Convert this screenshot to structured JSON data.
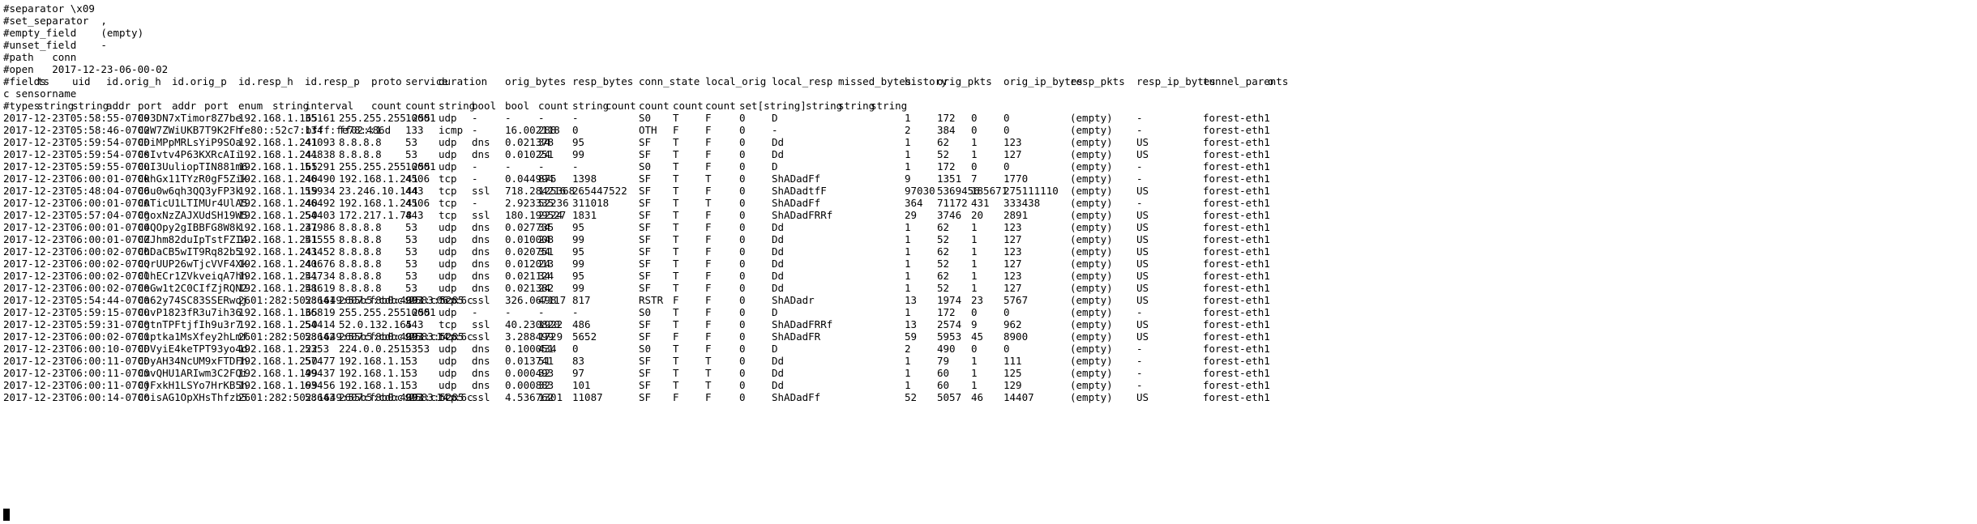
{
  "header": [
    "#separator \\x09",
    "#set_separator  ,",
    "#empty_field    (empty)",
    "#unset_field    -",
    "#path   conn",
    "#open   2017-12-23-06-00-02"
  ],
  "fields_line": [
    "#fields",
    "ts",
    "uid",
    "id.orig_h",
    "id.orig_p",
    "id.resp_h",
    "id.resp_p",
    "proto",
    "service",
    "duration",
    "orig_bytes",
    "resp_bytes",
    "conn_state",
    "local_orig",
    "local_resp",
    "missed_bytes",
    "history",
    "orig_pkts",
    "orig_ip_bytes",
    "resp_pkts",
    "resp_ip_bytes",
    "tunnel_parents",
    "o"
  ],
  "fields_wrap": "c sensorname",
  "types_line": [
    "#types",
    "string",
    "string",
    "addr",
    "port",
    "addr",
    "port",
    "enum",
    "string",
    "interval",
    "count",
    "count",
    "string",
    "bool",
    "bool",
    "count",
    "string",
    "count",
    "count",
    "count",
    "count",
    "set[string]",
    "string",
    "string",
    "string"
  ],
  "rows": [
    [
      "2017-12-23T05:58:55-0700",
      "C93DN7xTimor8Z7be",
      "192.168.1.165",
      "35161",
      "255.255.255.255",
      "10001",
      "udp",
      "-",
      "-",
      "-",
      "-",
      "S0",
      "T",
      "F",
      "0",
      "D",
      "1",
      "172",
      "0",
      "0",
      "(empty)",
      "-",
      "forest-eth1"
    ],
    [
      "2017-12-23T05:58:46-0700",
      "C2W7ZWiUKB7T9K2Fh",
      "fe80::52c7:bfff:fe78:486d",
      "134",
      "ff02::1",
      "133",
      "icmp",
      "-",
      "16.002118",
      "288",
      "0",
      "OTH",
      "F",
      "F",
      "0",
      "-",
      "2",
      "384",
      "0",
      "0",
      "(empty)",
      "-",
      "forest-eth1"
    ],
    [
      "2017-12-23T05:59:54-0700",
      "CDiMPpMRLsYiP9SOa",
      "192.168.1.241",
      "41093",
      "8.8.8.8",
      "53",
      "udp",
      "dns",
      "0.021378",
      "34",
      "95",
      "SF",
      "T",
      "F",
      "0",
      "Dd",
      "1",
      "62",
      "1",
      "123",
      "(empty)",
      "US",
      "forest-eth1"
    ],
    [
      "2017-12-23T05:59:54-0700",
      "CsIvtv4P63KXRcAIi",
      "192.168.1.241",
      "44838",
      "8.8.8.8",
      "53",
      "udp",
      "dns",
      "0.010251",
      "24",
      "99",
      "SF",
      "T",
      "F",
      "0",
      "Dd",
      "1",
      "52",
      "1",
      "127",
      "(empty)",
      "US",
      "forest-eth1"
    ],
    [
      "2017-12-23T05:59:55-0700",
      "CuI3UuliopTIN881m6",
      "192.168.1.165",
      "51291",
      "255.255.255.255",
      "10001",
      "udp",
      "-",
      "-",
      "-",
      "-",
      "S0",
      "T",
      "F",
      "0",
      "D",
      "1",
      "172",
      "0",
      "0",
      "(empty)",
      "-",
      "forest-eth1"
    ],
    [
      "2017-12-23T06:00:01-0700",
      "CkhGx11TYzR0gF5Zik",
      "192.168.1.240",
      "46490",
      "192.168.1.241",
      "4506",
      "tcp",
      "-",
      "0.044994",
      "875",
      "1398",
      "SF",
      "T",
      "T",
      "0",
      "ShADadFf",
      "9",
      "1351",
      "7",
      "1770",
      "(empty)",
      "-",
      "forest-eth1"
    ],
    [
      "2017-12-23T05:48:04-0700",
      "C6u0w6qh3QQ3yFP3k",
      "192.168.1.119",
      "55934",
      "23.246.10.144",
      "443",
      "tcp",
      "ssl",
      "718.284216",
      "125368",
      "265447522",
      "SF",
      "T",
      "F",
      "0",
      "ShADadtfF",
      "97030",
      "5369456",
      "185671",
      "275111110",
      "(empty)",
      "US",
      "forest-eth1"
    ],
    [
      "2017-12-23T06:00:01-0700",
      "CATicU1LTIMUr4UlA5",
      "192.168.1.240",
      "46492",
      "192.168.1.241",
      "4506",
      "tcp",
      "-",
      "2.923335",
      "52236",
      "311018",
      "SF",
      "T",
      "T",
      "0",
      "ShADadFf",
      "364",
      "71172",
      "431",
      "333438",
      "(empty)",
      "-",
      "forest-eth1"
    ],
    [
      "2017-12-23T05:57:04-0700",
      "CgoxNzZAJXUdSH19W5",
      "192.168.1.250",
      "54403",
      "172.217.1.78",
      "443",
      "tcp",
      "ssl",
      "180.199527",
      "2224",
      "1831",
      "SF",
      "T",
      "F",
      "0",
      "ShADadFRRf",
      "29",
      "3746",
      "20",
      "2891",
      "(empty)",
      "US",
      "forest-eth1"
    ],
    [
      "2017-12-23T06:00:01-0700",
      "C4QOpy2gIBBFG8W8k",
      "192.168.1.241",
      "37986",
      "8.8.8.8",
      "53",
      "udp",
      "dns",
      "0.027735",
      "34",
      "95",
      "SF",
      "T",
      "F",
      "0",
      "Dd",
      "1",
      "62",
      "1",
      "123",
      "(empty)",
      "US",
      "forest-eth1"
    ],
    [
      "2017-12-23T06:00:01-0700",
      "CZJhm82duIpTstFZI4",
      "192.168.1.241",
      "51555",
      "8.8.8.8",
      "53",
      "udp",
      "dns",
      "0.010008",
      "24",
      "99",
      "SF",
      "T",
      "F",
      "0",
      "Dd",
      "1",
      "52",
      "1",
      "127",
      "(empty)",
      "US",
      "forest-eth1"
    ],
    [
      "2017-12-23T06:00:02-0700",
      "ChDaCB5wIT9Rq82b5",
      "192.168.1.241",
      "43452",
      "8.8.8.8",
      "53",
      "udp",
      "dns",
      "0.020751",
      "34",
      "95",
      "SF",
      "T",
      "F",
      "0",
      "Dd",
      "1",
      "62",
      "1",
      "123",
      "(empty)",
      "US",
      "forest-eth1"
    ],
    [
      "2017-12-23T06:00:02-0700",
      "CQrUUP26wTjcVVF4Xk",
      "192.168.1.241",
      "40676",
      "8.8.8.8",
      "53",
      "udp",
      "dns",
      "0.012013",
      "24",
      "99",
      "SF",
      "T",
      "F",
      "0",
      "Dd",
      "1",
      "52",
      "1",
      "127",
      "(empty)",
      "US",
      "forest-eth1"
    ],
    [
      "2017-12-23T06:00:02-0700",
      "ClhECr1ZVkveiqA7hh",
      "192.168.1.241",
      "54734",
      "8.8.8.8",
      "53",
      "udp",
      "dns",
      "0.021124",
      "34",
      "95",
      "SF",
      "T",
      "F",
      "0",
      "Dd",
      "1",
      "62",
      "1",
      "123",
      "(empty)",
      "US",
      "forest-eth1"
    ],
    [
      "2017-12-23T06:00:02-0700",
      "CeGw1t2C0CIfZjRQN2",
      "192.168.1.241",
      "58619",
      "8.8.8.8",
      "53",
      "udp",
      "dns",
      "0.021382",
      "24",
      "99",
      "SF",
      "T",
      "F",
      "0",
      "Dd",
      "1",
      "52",
      "1",
      "127",
      "(empty)",
      "US",
      "forest-eth1"
    ],
    [
      "2017-12-23T05:54:44-0700",
      "Ca62y74SC83SSERwqj",
      "2601:282:502:1649:55b5:cdbc:2583:5285",
      "58641",
      "2607:f8b0:4001:c06::6c",
      "993",
      "tcp",
      "ssl",
      "326.067117",
      "498",
      "817",
      "RSTR",
      "F",
      "F",
      "0",
      "ShADadr",
      "13",
      "1974",
      "23",
      "5767",
      "(empty)",
      "US",
      "forest-eth1"
    ],
    [
      "2017-12-23T05:59:15-0700",
      "CuvP1823fR3u7ih36",
      "192.168.1.165",
      "36819",
      "255.255.255.255",
      "10001",
      "udp",
      "-",
      "-",
      "-",
      "-",
      "S0",
      "T",
      "F",
      "0",
      "D",
      "1",
      "172",
      "0",
      "0",
      "(empty)",
      "-",
      "forest-eth1"
    ],
    [
      "2017-12-23T05:59:31-0700",
      "CgtnTPFtjfIh9u3r7",
      "192.168.1.250",
      "54414",
      "52.0.132.165",
      "443",
      "tcp",
      "ssl",
      "40.230820",
      "1922",
      "486",
      "SF",
      "T",
      "F",
      "0",
      "ShADadFRRf",
      "13",
      "2574",
      "9",
      "962",
      "(empty)",
      "US",
      "forest-eth1"
    ],
    [
      "2017-12-23T06:00:02-0700",
      "Ciptka1MsXfey2hLmf",
      "2601:282:502:1649:55b5:cdbc:2583:5285",
      "58642",
      "2607:f8b0:4001:c14::6c",
      "993",
      "tcp",
      "ssl",
      "3.288499",
      "1729",
      "5652",
      "SF",
      "F",
      "F",
      "0",
      "ShADadFR",
      "59",
      "5953",
      "45",
      "8900",
      "(empty)",
      "US",
      "forest-eth1"
    ],
    [
      "2017-12-23T06:00:10-0700",
      "CDVyiE4keTPT93yo4d",
      "192.168.1.222",
      "5353",
      "224.0.0.251",
      "5353",
      "udp",
      "dns",
      "0.100051",
      "434",
      "0",
      "S0",
      "T",
      "F",
      "0",
      "D",
      "2",
      "490",
      "0",
      "0",
      "(empty)",
      "-",
      "forest-eth1"
    ],
    [
      "2017-12-23T06:00:11-0700",
      "CDyAH34NcUM9xFTDFh",
      "192.168.1.250",
      "57477",
      "192.168.1.1",
      "53",
      "udp",
      "dns",
      "0.013741",
      "51",
      "83",
      "SF",
      "T",
      "T",
      "0",
      "Dd",
      "1",
      "79",
      "1",
      "111",
      "(empty)",
      "-",
      "forest-eth1"
    ],
    [
      "2017-12-23T06:00:11-0700",
      "CmvQHU1ARIwm3C2FQi",
      "192.168.1.199",
      "49437",
      "192.168.1.1",
      "53",
      "udp",
      "dns",
      "0.000493",
      "32",
      "97",
      "SF",
      "T",
      "T",
      "0",
      "Dd",
      "1",
      "60",
      "1",
      "125",
      "(empty)",
      "-",
      "forest-eth1"
    ],
    [
      "2017-12-23T06:00:11-0700",
      "CjFxkH1LSYo7HrKB5h",
      "192.168.1.199",
      "63456",
      "192.168.1.1",
      "53",
      "udp",
      "dns",
      "0.000883",
      "32",
      "101",
      "SF",
      "T",
      "T",
      "0",
      "Dd",
      "1",
      "60",
      "1",
      "129",
      "(empty)",
      "-",
      "forest-eth1"
    ],
    [
      "2017-12-23T06:00:14-0700",
      "CoisAG1OpXHsThfzb5",
      "2601:282:502:1649:55b5:cdbc:2583:5285",
      "58643",
      "2607:f8b0:4001:c14::6c",
      "993",
      "tcp",
      "ssl",
      "4.536762",
      "1301",
      "11087",
      "SF",
      "F",
      "F",
      "0",
      "ShADadFf",
      "52",
      "5057",
      "46",
      "14407",
      "(empty)",
      "US",
      "forest-eth1"
    ]
  ],
  "prompt": ":"
}
